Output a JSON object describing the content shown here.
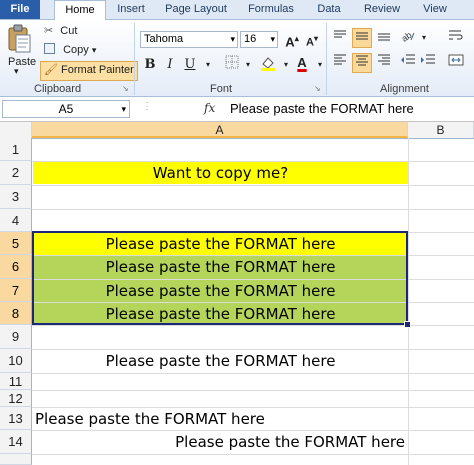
{
  "tabs": [
    "File",
    "Home",
    "Insert",
    "Page Layout",
    "Formulas",
    "Data",
    "Review",
    "View"
  ],
  "clipboard": {
    "paste": "Paste",
    "cut": "Cut",
    "copy": "Copy",
    "format_painter": "Format Painter",
    "group": "Clipboard"
  },
  "font": {
    "name": "Tahoma",
    "size": "16",
    "group": "Font"
  },
  "alignment": {
    "group": "Alignment"
  },
  "name_box": "A5",
  "fx": "fx",
  "formula": "Please paste the FORMAT here",
  "columns": [
    "A",
    "B"
  ],
  "rows": [
    "1",
    "2",
    "3",
    "4",
    "5",
    "6",
    "7",
    "8",
    "9",
    "10",
    "11",
    "12",
    "13",
    "14"
  ],
  "cells": {
    "r2": "Want to copy me?",
    "r5": "Please paste the FORMAT here",
    "r6": "Please paste the FORMAT here",
    "r7": "Please paste the FORMAT here",
    "r8": "Please paste the FORMAT here",
    "r10": "Please paste the FORMAT here",
    "r13": "Please paste the FORMAT here",
    "r14": "Please paste the FORMAT here"
  },
  "colors": {
    "yellow": "#ffff00",
    "green": "#b5d55a",
    "selection_border": "#1c2877"
  }
}
